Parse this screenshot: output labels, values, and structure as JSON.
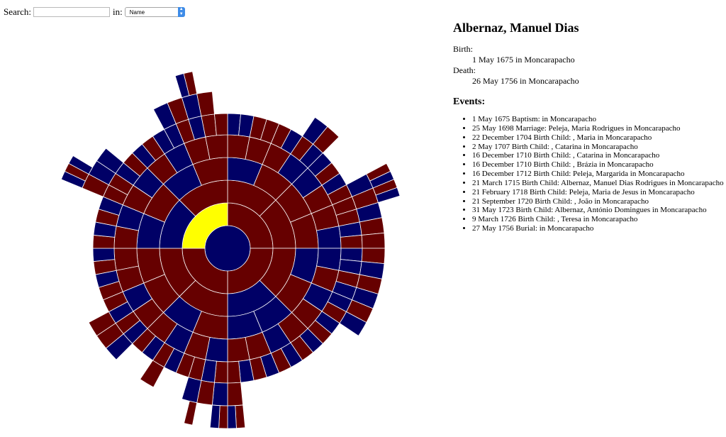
{
  "search": {
    "label": "Search:",
    "value": "",
    "in_label": "in:",
    "field_select": "Name"
  },
  "colors": {
    "blue": "#000066",
    "red": "#660000",
    "selected": "#ffff00",
    "divider": "#ffffff"
  },
  "person": {
    "name": "Albernaz, Manuel Dias",
    "birth_label": "Birth:",
    "birth_value": "1 May 1675 in Moncarapacho",
    "death_label": "Death:",
    "death_value": "26 May 1756 in Moncarapacho"
  },
  "events_title": "Events:",
  "events": [
    "1 May 1675 Baptism: in Moncarapacho",
    "25 May 1698 Marriage: Peleja, Maria Rodrigues in Moncarapacho",
    "22 December 1704 Birth Child: , Maria in Moncarapacho",
    "2 May 1707 Birth Child: , Catarina in Moncarapacho",
    "16 December 1710 Birth Child: , Catarina in Moncarapacho",
    "16 December 1710 Birth Child: , Brázia in Moncarapacho",
    "16 December 1712 Birth Child: Peleja, Margarida in Moncarapacho",
    "21 March 1715 Birth Child: Albernaz, Manuel Dias Rodrigues in Moncarapacho",
    "21 February 1718 Birth Child: Peleja, Maria de Jesus in Moncarapacho",
    "21 September 1720 Birth Child: , João in Moncarapacho",
    "31 May 1723 Birth Child: Albernaz, António Domingues in Moncarapacho",
    "9 March 1726 Birth Child: , Teresa in Moncarapacho",
    "27 May 1756 Burial: in Moncarapacho"
  ]
}
